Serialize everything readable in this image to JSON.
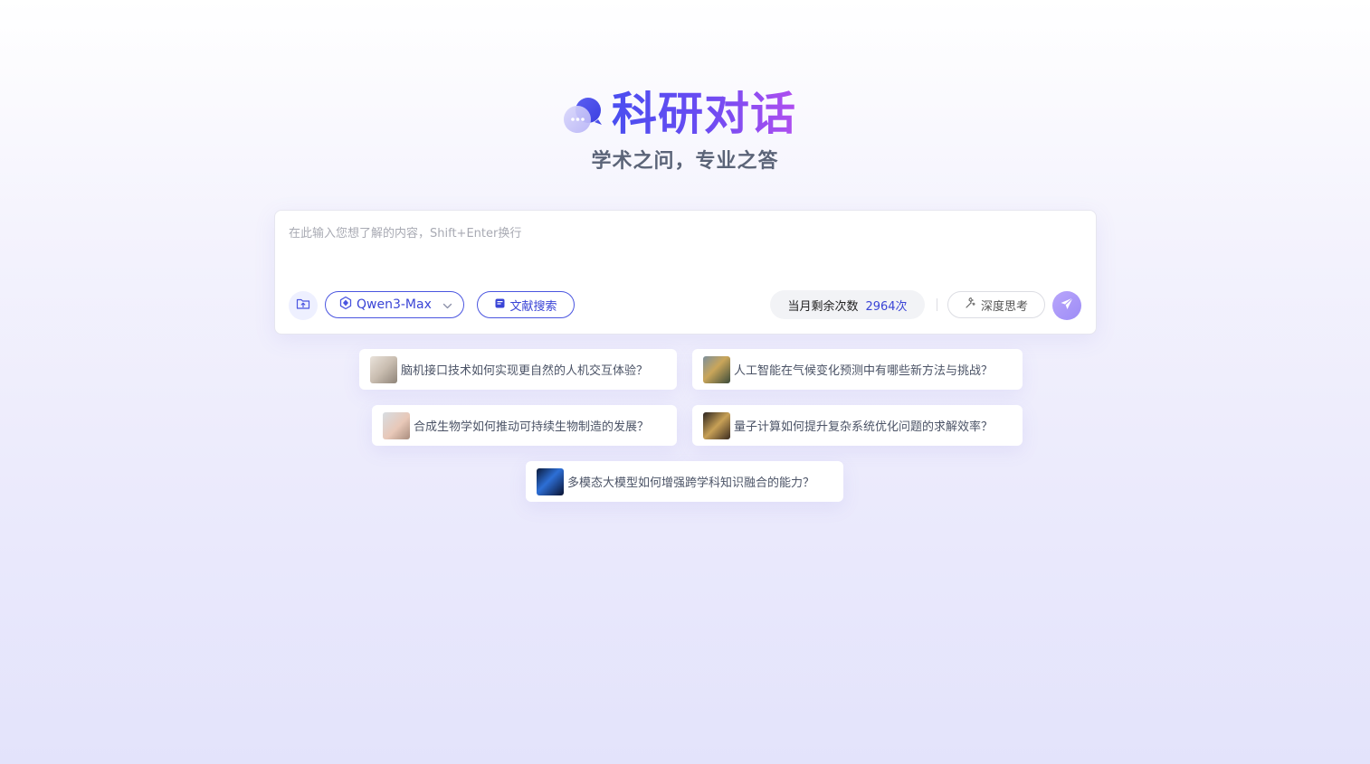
{
  "header": {
    "title": "科研对话",
    "subtitle": "学术之问，专业之答"
  },
  "chat": {
    "placeholder": "在此输入您想了解的内容，Shift+Enter换行",
    "model_label": "Qwen3-Max",
    "literature_label": "文献搜索",
    "quota_label": "当月剩余次数",
    "quota_value": "2964次",
    "deep_label": "深度思考"
  },
  "suggestions": [
    {
      "text": "脑机接口技术如何实现更自然的人机交互体验？"
    },
    {
      "text": "人工智能在气候变化预测中有哪些新方法与挑战？"
    },
    {
      "text": "合成生物学如何推动可持续生物制造的发展？"
    },
    {
      "text": "量子计算如何提升复杂系统优化问题的求解效率？"
    },
    {
      "text": "多模态大模型如何增强跨学科知识融合的能力？"
    }
  ],
  "colors": {
    "accent": "#3a44d6",
    "title_gradient_start": "#4a4ef0",
    "title_gradient_end": "#b04ef0",
    "send_button": "#a996f8"
  }
}
